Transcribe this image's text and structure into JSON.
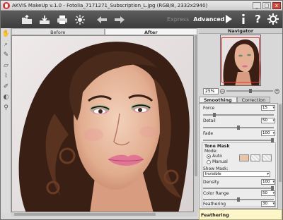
{
  "app": {
    "title": "AKVIS MakeUp v.1.0 - Fotolia_7171271_Subscription_L.jpg (RGB/8, 2332x2940)"
  },
  "window_controls": {
    "minimize": "_",
    "maximize": "□",
    "close": "x"
  },
  "toolbar": {
    "modes": {
      "express": "Express",
      "advanced": "Advanced"
    },
    "icons": [
      "open-icon",
      "save-icon",
      "print-icon",
      "batch-icon",
      "undo-icon",
      "redo-icon",
      "run-icon",
      "info-icon",
      "help-icon",
      "settings-icon"
    ]
  },
  "tools": [
    "hand-icon",
    "zoom-icon",
    "brush-icon",
    "eraser-icon",
    "dropper-icon",
    "pencil-icon",
    "clone-icon",
    "magnifier-icon"
  ],
  "view_tabs": {
    "before": "Before",
    "after": "After"
  },
  "navigator": {
    "title": "Navigator",
    "zoom": "25%"
  },
  "panel_tabs": {
    "smoothing": "Smoothing",
    "correction": "Correction"
  },
  "smoothing": {
    "force": {
      "label": "Force",
      "value": "15",
      "level": 0.15
    },
    "detail": {
      "label": "Detail",
      "value": "50",
      "level": 0.5
    },
    "fade": {
      "label": "Fade",
      "value": "100",
      "level": 1.0
    }
  },
  "tone_mask": {
    "title": "Tone Mask",
    "mode_label": "Mode:",
    "auto": "Auto",
    "manual": "Manual",
    "show_mask_label": "Show Mask:",
    "show_mask_value": "Invisible",
    "density": {
      "label": "Density",
      "value": "100",
      "level": 1.0
    },
    "color_range": {
      "label": "Color Range",
      "value": "50",
      "level": 0.5
    },
    "feathering": {
      "label": "Feathering",
      "value": "30",
      "level": 0.3
    }
  },
  "help_text": "Feathering",
  "colors": {
    "toolbar": "#4a4a4a",
    "skin_swatch": "#e8c4a8",
    "nav_frame": "#e33333"
  }
}
